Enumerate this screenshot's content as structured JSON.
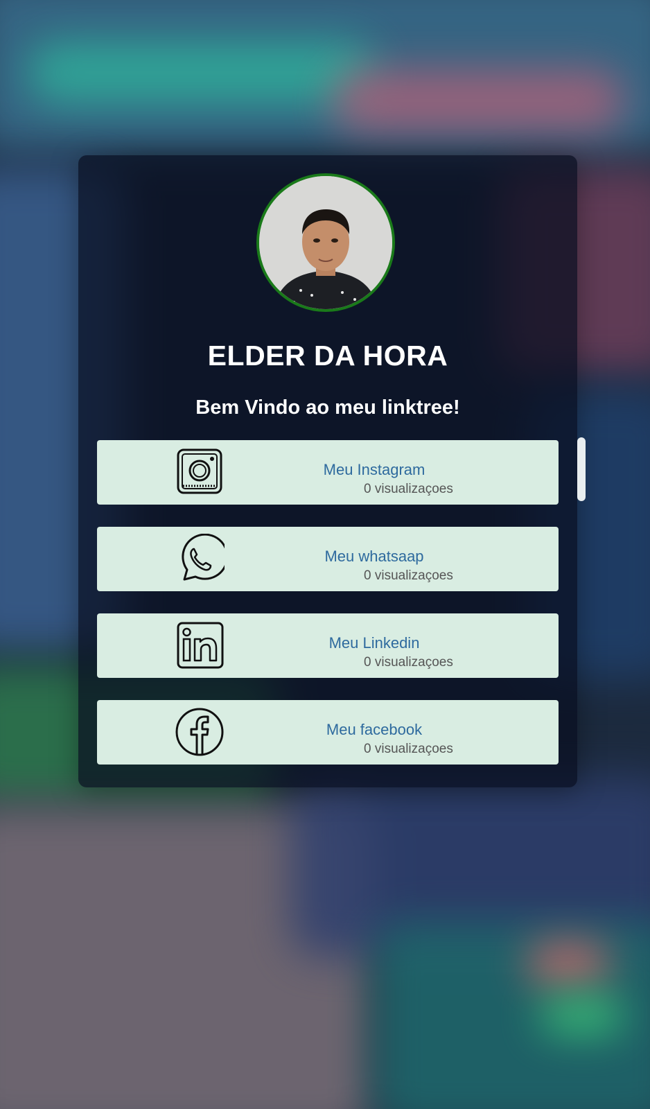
{
  "profile": {
    "name": "ELDER DA HORA",
    "welcome": "Bem Vindo ao meu linktree!",
    "avatar_border_color": "#1a7a1a"
  },
  "links": [
    {
      "icon": "instagram-icon",
      "title": "Meu Instagram",
      "views": "0 visualizaçoes"
    },
    {
      "icon": "whatsapp-icon",
      "title": "Meu whatsaap",
      "views": "0 visualizaçoes"
    },
    {
      "icon": "linkedin-icon",
      "title": "Meu Linkedin",
      "views": "0 visualizaçoes"
    },
    {
      "icon": "facebook-icon",
      "title": "Meu facebook",
      "views": "0 visualizaçoes"
    }
  ],
  "colors": {
    "card_background": "#d9ede2",
    "title_color": "#2e6a9e",
    "panel_background": "#080e20"
  }
}
